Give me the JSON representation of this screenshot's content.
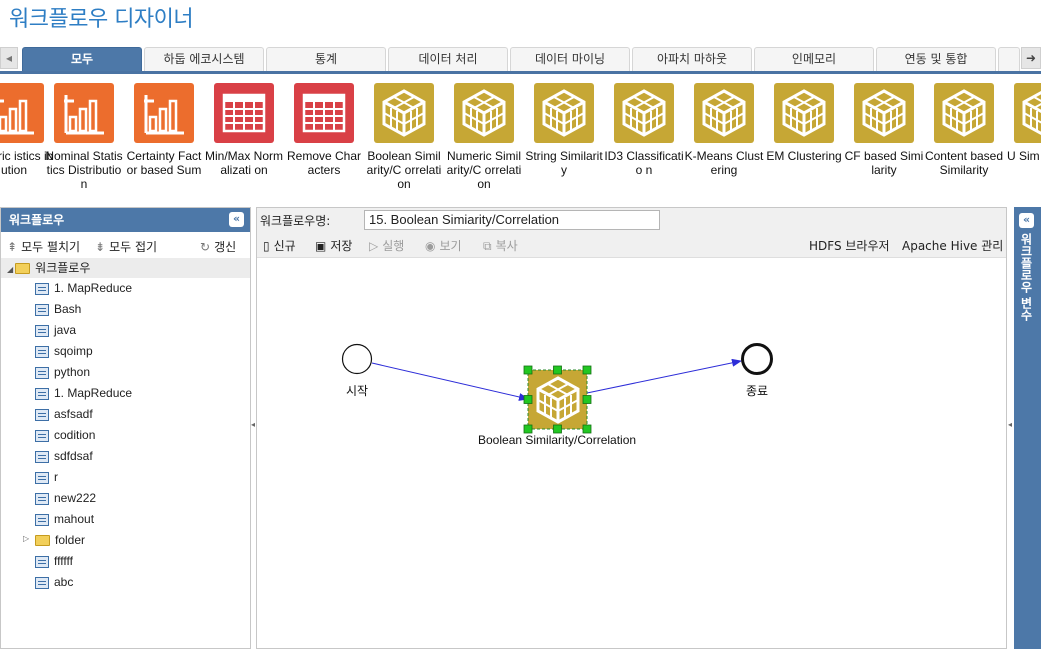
{
  "app": {
    "title": "워크플로우 디자이너"
  },
  "tabs": {
    "prev_arrow": "◂",
    "next_arrow": "➜",
    "items": [
      {
        "label": "모두",
        "active": true
      },
      {
        "label": "하둡 에코시스템",
        "active": false
      },
      {
        "label": "통계",
        "active": false
      },
      {
        "label": "데이터 처리",
        "active": false
      },
      {
        "label": "데이터 마이닝",
        "active": false
      },
      {
        "label": "아파치 마하웃",
        "active": false
      },
      {
        "label": "인메모리",
        "active": false
      },
      {
        "label": "연동 및 통합",
        "active": false
      }
    ]
  },
  "palette": {
    "items": [
      {
        "label": "umeric istics ibution",
        "icon": "bar-chart-icon",
        "color": "#ec6d2d"
      },
      {
        "label": "Nominal Statistics Distribution",
        "icon": "bar-chart-icon",
        "color": "#ec6d2d"
      },
      {
        "label": "Certainty Factor based Sum",
        "icon": "bar-chart-icon",
        "color": "#ec6d2d"
      },
      {
        "label": "Min/Max Normalizati on",
        "icon": "table-icon",
        "color": "#d94046"
      },
      {
        "label": "Remove Characters",
        "icon": "table-icon",
        "color": "#d94046"
      },
      {
        "label": "Boolean Similarity/C orrelation",
        "icon": "cube-icon",
        "color": "#c6a735"
      },
      {
        "label": "Numeric Similarity/C orrelation",
        "icon": "cube-icon",
        "color": "#c6a735"
      },
      {
        "label": "String Similarity",
        "icon": "cube-icon",
        "color": "#c6a735"
      },
      {
        "label": "ID3 Classificatio n",
        "icon": "cube-icon",
        "color": "#c6a735"
      },
      {
        "label": "K-Means Clustering",
        "icon": "cube-icon",
        "color": "#c6a735"
      },
      {
        "label": "EM Clustering",
        "icon": "cube-icon",
        "color": "#c6a735"
      },
      {
        "label": "CF based Similarity",
        "icon": "cube-icon",
        "color": "#c6a735"
      },
      {
        "label": "Content based Similarity",
        "icon": "cube-icon",
        "color": "#c6a735"
      },
      {
        "label": "U Sim ba Reco",
        "icon": "cube-icon",
        "color": "#c6a735"
      }
    ]
  },
  "left_panel": {
    "title": "워크플로우",
    "collapse_icon": "«",
    "toolbar": {
      "expand_all": "모두 펼치기",
      "collapse_all": "모두 접기",
      "refresh": "갱신"
    },
    "tree": {
      "root": "워크플로우",
      "items": [
        {
          "label": "1. MapReduce",
          "type": "workflow"
        },
        {
          "label": "Bash",
          "type": "workflow"
        },
        {
          "label": "java",
          "type": "workflow"
        },
        {
          "label": "sqoimp",
          "type": "workflow"
        },
        {
          "label": "python",
          "type": "workflow"
        },
        {
          "label": "1. MapReduce",
          "type": "workflow"
        },
        {
          "label": "asfsadf",
          "type": "workflow"
        },
        {
          "label": "codition",
          "type": "workflow"
        },
        {
          "label": "sdfdsaf",
          "type": "workflow"
        },
        {
          "label": "r",
          "type": "workflow"
        },
        {
          "label": "new222",
          "type": "workflow"
        },
        {
          "label": "mahout",
          "type": "workflow"
        },
        {
          "label": "folder",
          "type": "folder"
        },
        {
          "label": "ffffff",
          "type": "workflow"
        },
        {
          "label": "abc",
          "type": "workflow"
        }
      ]
    }
  },
  "main": {
    "name_label": "워크플로우명:",
    "name_value": "15. Boolean Simiarity/Correlation",
    "toolbar": {
      "new": "신규",
      "save": "저장",
      "run": "실행",
      "view": "보기",
      "copy": "복사",
      "hdfs_browser": "HDFS 브라우저",
      "hive_admin": "Apache Hive 관리"
    },
    "canvas": {
      "start_label": "시작",
      "end_label": "종료",
      "node_label": "Boolean Similarity/Correlation",
      "node_icon": "cube-icon",
      "node_color": "#c6a735",
      "edge_color": "#2d2dd8",
      "handle_color": "#22c722"
    }
  },
  "right_panel": {
    "title": "워크플로우 변수",
    "collapse_icon": "«"
  }
}
